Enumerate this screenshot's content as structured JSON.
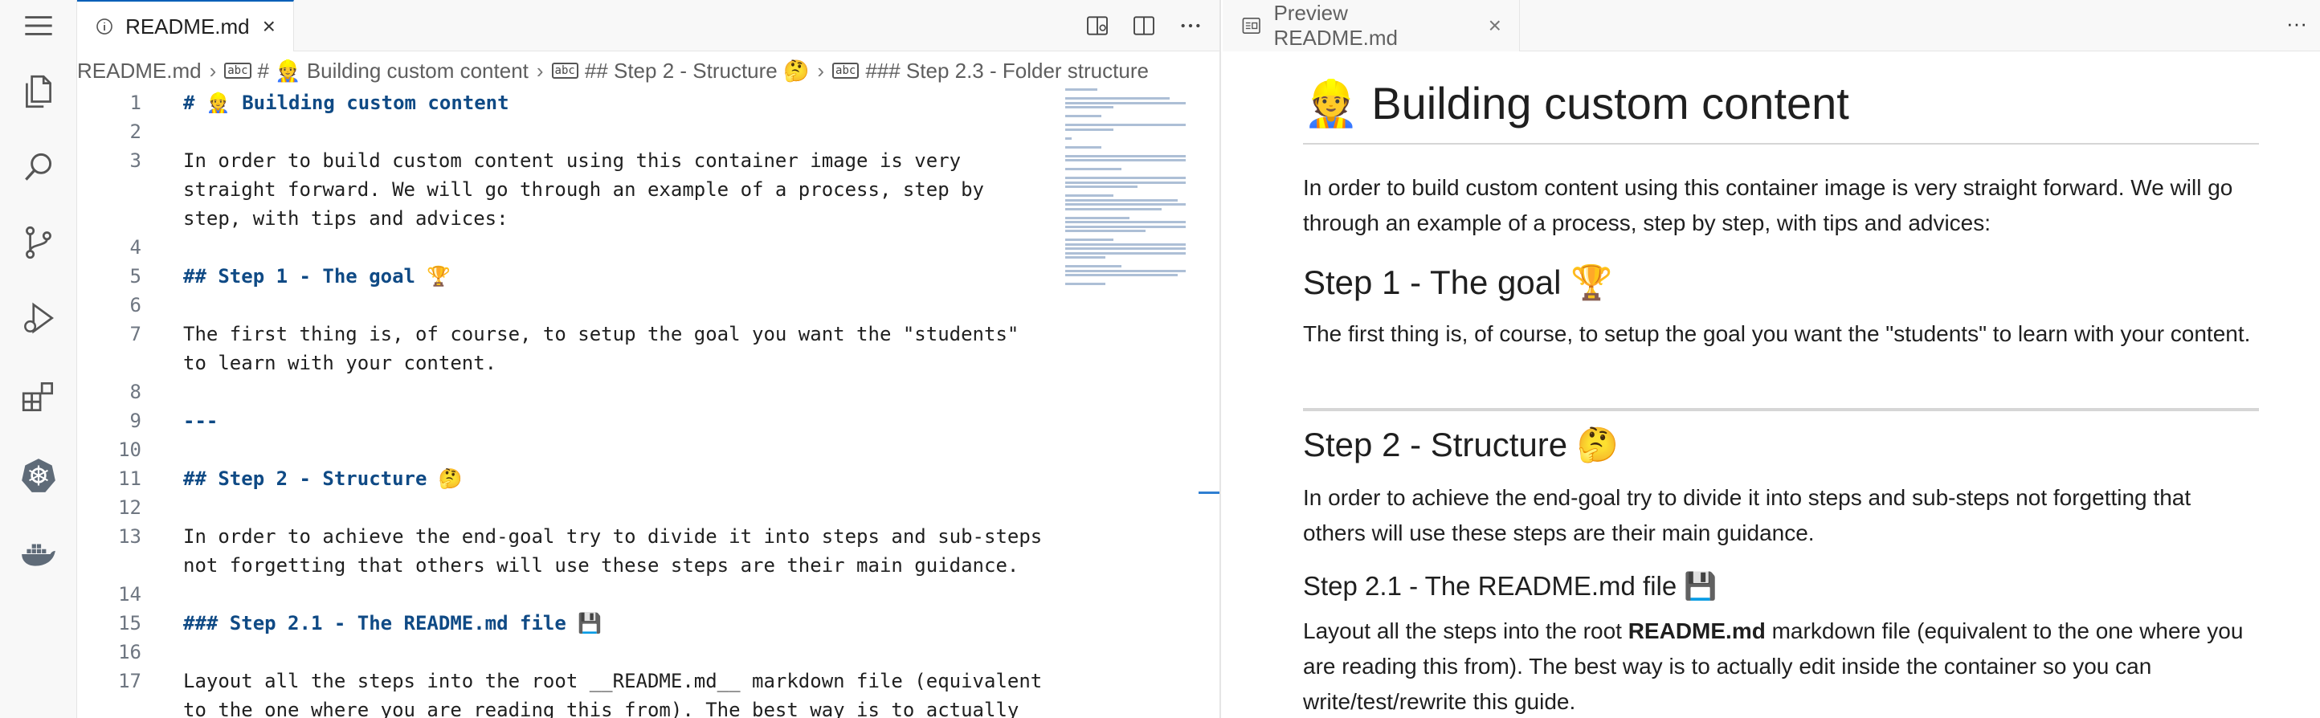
{
  "editor": {
    "tab": {
      "title": "README.md",
      "close": "×"
    },
    "breadcrumb": {
      "file": "README.md",
      "abc": "abc",
      "b1": "# 👷 Building custom content",
      "b2": "## Step 2 - Structure 🤔",
      "b3": "### Step 2.3 - Folder structure"
    },
    "lines": [
      {
        "n": "1",
        "text": "# 👷 Building custom content"
      },
      {
        "n": "2",
        "text": ""
      },
      {
        "n": "3",
        "text": "In order to build custom content using this container image is very"
      },
      {
        "n": "",
        "text": "straight forward. We will go through an example of a process, step by"
      },
      {
        "n": "",
        "text": "step, with tips and advices:"
      },
      {
        "n": "4",
        "text": ""
      },
      {
        "n": "5",
        "text": "## Step 1 - The goal 🏆"
      },
      {
        "n": "6",
        "text": ""
      },
      {
        "n": "7",
        "text": "The first thing is, of course, to setup the goal you want the \"students\""
      },
      {
        "n": "",
        "text": "to learn with your content."
      },
      {
        "n": "8",
        "text": ""
      },
      {
        "n": "9",
        "text": "---"
      },
      {
        "n": "10",
        "text": ""
      },
      {
        "n": "11",
        "text": "## Step 2 - Structure 🤔"
      },
      {
        "n": "12",
        "text": ""
      },
      {
        "n": "13",
        "text": "In order to achieve the end-goal try to divide it into steps and sub-steps"
      },
      {
        "n": "",
        "text": "not forgetting that others will use these steps are their main guidance."
      },
      {
        "n": "14",
        "text": ""
      },
      {
        "n": "15",
        "text": "### Step 2.1 - The README.md file 💾"
      },
      {
        "n": "16",
        "text": ""
      },
      {
        "n": "17",
        "text": "Layout all the steps into the root __README.md__ markdown file (equivalent"
      },
      {
        "n": "",
        "text": "to the one where you are reading this from). The best way is to actually"
      }
    ]
  },
  "preview": {
    "tab": {
      "title": "Preview README.md",
      "close": "×",
      "more": "···"
    },
    "h1": "👷 Building custom content",
    "p1": "In order to build custom content using this container image is very straight forward. We will go through an example of a process, step by step, with tips and advices:",
    "h2a": "Step 1 - The goal 🏆",
    "p2": "The first thing is, of course, to setup the goal you want the \"students\" to learn with your content.",
    "h2b": "Step 2 - Structure 🤔",
    "p3": "In order to achieve the end-goal try to divide it into steps and sub-steps not forgetting that others will use these steps are their main guidance.",
    "h3a": "Step 2.1 - The README.md file 💾",
    "p4_pre": "Layout all the steps into the root ",
    "p4_bold": "README.md",
    "p4_post": " markdown file (equivalent to the one where you are reading this from). The best way is to actually edit inside the container so you can write/test/rewrite this guide."
  },
  "icons": {
    "activity": [
      "menu-icon",
      "explorer-icon",
      "search-icon",
      "source-control-icon",
      "run-debug-icon",
      "extensions-icon",
      "kubernetes-icon",
      "docker-icon"
    ]
  }
}
